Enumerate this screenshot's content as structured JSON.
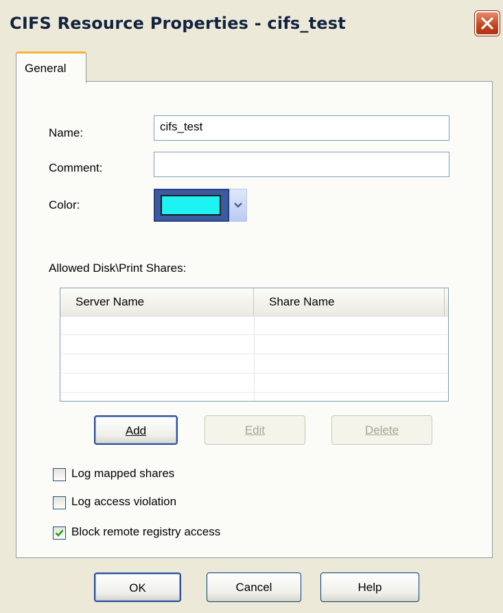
{
  "window": {
    "title": "CIFS Resource Properties - cifs_test"
  },
  "tabs": [
    {
      "label": "General",
      "selected": true
    }
  ],
  "form": {
    "name_label": "Name:",
    "name_value": "cifs_test",
    "comment_label": "Comment:",
    "comment_value": "",
    "color_label": "Color:",
    "color_value": "#1ef2f2"
  },
  "shares": {
    "label": "Allowed Disk\\Print Shares:",
    "columns": [
      "Server Name",
      "Share Name"
    ],
    "rows": []
  },
  "share_buttons": {
    "add": "Add",
    "edit": "Edit",
    "delete": "Delete"
  },
  "options": [
    {
      "label": "Log mapped shares",
      "checked": false
    },
    {
      "label": "Log access violation",
      "checked": false
    },
    {
      "label": "Block remote registry access",
      "checked": true
    }
  ],
  "dialog_buttons": {
    "ok": "OK",
    "cancel": "Cancel",
    "help": "Help"
  },
  "icons": {
    "close": "close-icon",
    "dropdown": "chevron-down-icon",
    "check": "checkmark-icon"
  }
}
